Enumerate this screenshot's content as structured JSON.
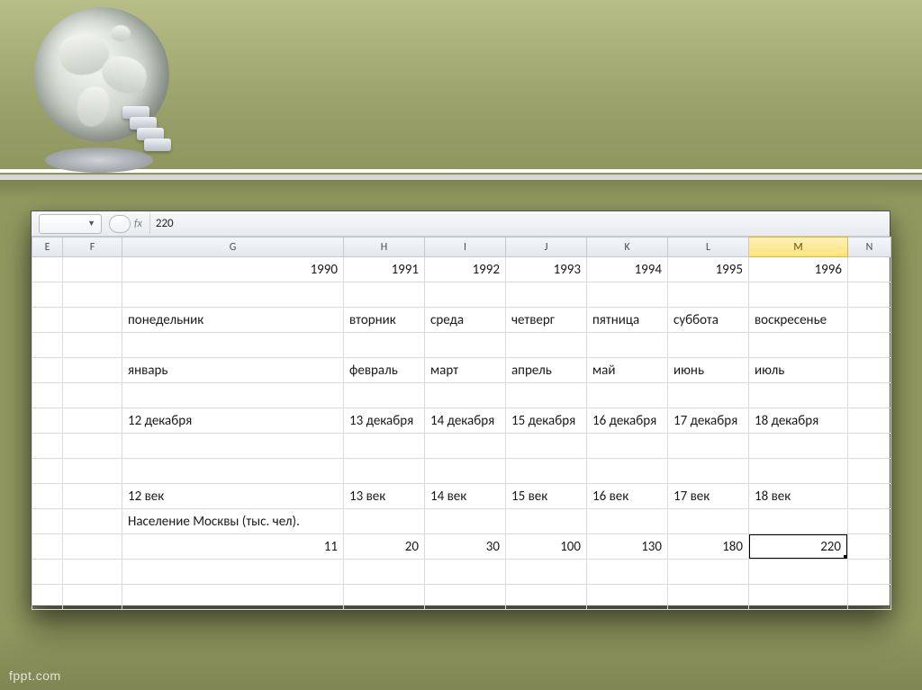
{
  "footer": {
    "brand": "fppt.com"
  },
  "formula_bar": {
    "fx_label": "fx",
    "value": "220",
    "namebox_value": ""
  },
  "columns": [
    "E",
    "F",
    "G",
    "H",
    "I",
    "J",
    "K",
    "L",
    "M",
    "N"
  ],
  "active_column": "M",
  "rows": [
    {
      "type": "num",
      "G": "1990",
      "H": "1991",
      "I": "1992",
      "J": "1993",
      "K": "1994",
      "L": "1995",
      "M": "1996"
    },
    {
      "type": "empty"
    },
    {
      "type": "txt",
      "G": "понедельник",
      "H": "вторник",
      "I": "среда",
      "J": "четверг",
      "K": "пятница",
      "L": "суббота",
      "M": "воскресенье"
    },
    {
      "type": "empty"
    },
    {
      "type": "txt",
      "G": "январь",
      "H": "февраль",
      "I": "март",
      "J": "апрель",
      "K": "май",
      "L": "июнь",
      "M": "июль"
    },
    {
      "type": "empty"
    },
    {
      "type": "txt",
      "G": "12 декабря",
      "H": "13 декабря",
      "I": "14 декабря",
      "J": "15 декабря",
      "K": "16 декабря",
      "L": "17 декабря",
      "M": "18 декабря"
    },
    {
      "type": "empty"
    },
    {
      "type": "empty"
    },
    {
      "type": "txt",
      "G": "12 век",
      "H": "13 век",
      "I": "14 век",
      "J": "15 век",
      "K": "16 век",
      "L": "17 век",
      "M": "18 век"
    },
    {
      "type": "txt",
      "G": "Население Москвы (тыс. чел)."
    },
    {
      "type": "num",
      "G": "11",
      "H": "20",
      "I": "30",
      "J": "100",
      "K": "130",
      "L": "180",
      "M": "220",
      "selected": "M"
    },
    {
      "type": "empty"
    },
    {
      "type": "empty"
    }
  ]
}
